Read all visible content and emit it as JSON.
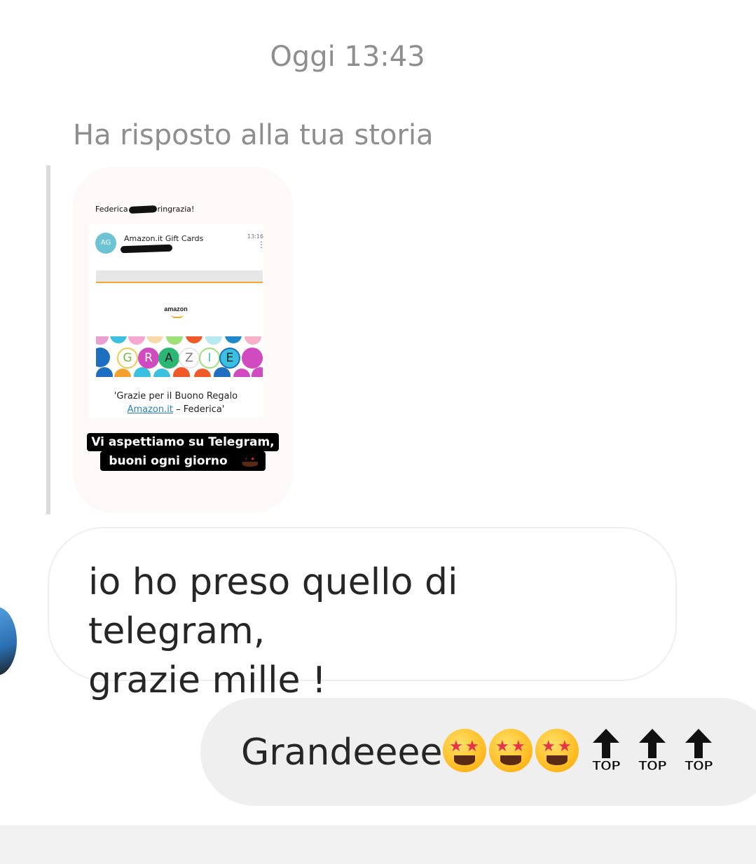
{
  "chat": {
    "timestamp": "Oggi 13:43",
    "reply_label": "Ha risposto alla tua storia"
  },
  "story": {
    "header_name": "Federica",
    "header_suffix": "ringrazia!",
    "email": {
      "avatar_initials": "AG",
      "sender": "Amazon.it Gift Cards",
      "time": "13:16",
      "logo_text": "amazon",
      "banner_letters": [
        "G",
        "R",
        "A",
        "Z",
        "I",
        "E"
      ],
      "quote_line1": "'Grazie per il Buono Regalo",
      "quote_link": "Amazon.it",
      "quote_line2_rest": " – Federica'"
    },
    "caption_line1": "Vi aspettiamo su Telegram,",
    "caption_line2": "buoni ogni giorno"
  },
  "messages": {
    "incoming_text": "io ho preso quello di  telegram,\ngrazie mille !",
    "outgoing_text": "Grandeeee",
    "outgoing_emojis": [
      "star-struck-emoji",
      "star-struck-emoji",
      "star-struck-emoji"
    ],
    "top_icons": [
      "TOP",
      "TOP",
      "TOP"
    ]
  }
}
